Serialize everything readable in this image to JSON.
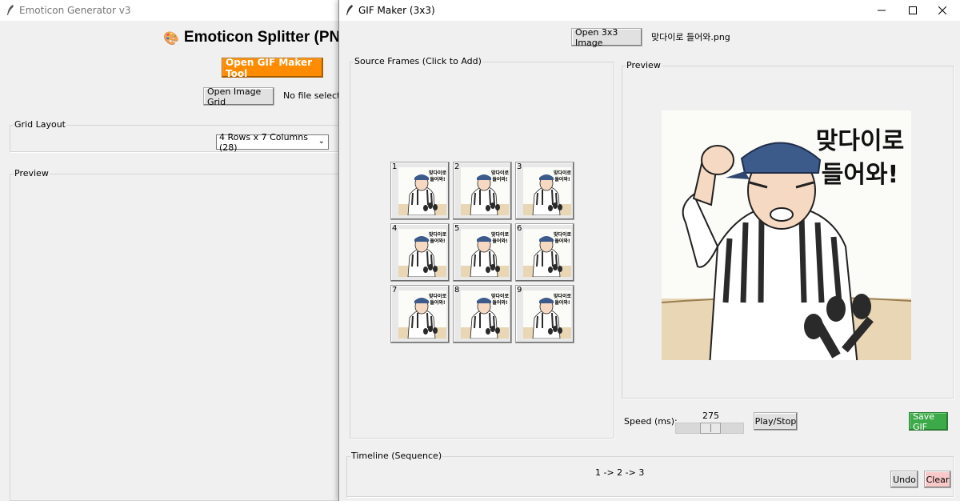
{
  "main_window": {
    "title": "Emoticon Generator v3",
    "heading": "Emoticon Splitter (PNG",
    "open_gif_button": "Open GIF Maker Tool",
    "open_grid_button": "Open Image Grid",
    "file_status": "No file selected",
    "grid_layout_label": "Grid Layout",
    "grid_select_value": "4 Rows x 7 Columns (28)",
    "preview_label": "Preview",
    "accent_orange": "#ff8c00"
  },
  "gif_window": {
    "title": "GIF Maker (3x3)",
    "open_button": "Open 3x3 Image",
    "file_name": "맞다이로 들어와.png",
    "source_frames_label": "Source Frames (Click to Add)",
    "preview_label": "Preview",
    "speed_label": "Speed (ms):",
    "speed_value": "275",
    "play_stop_button": "Play/Stop",
    "save_gif_button": "Save GIF",
    "timeline_label": "Timeline (Sequence)",
    "timeline_sequence": "1 -> 2 -> 3",
    "undo_button": "Undo",
    "clear_button": "Clear",
    "save_color": "#3daa4a",
    "clear_color": "#f9c8c8",
    "preview_caption_line1": "맞다이로",
    "preview_caption_line2": "들어와!",
    "thumb_caption_line1": "맞다이로",
    "thumb_caption_line2": "들어와!",
    "frames": [
      {
        "num": "1"
      },
      {
        "num": "2"
      },
      {
        "num": "3"
      },
      {
        "num": "4"
      },
      {
        "num": "5"
      },
      {
        "num": "6"
      },
      {
        "num": "7"
      },
      {
        "num": "8"
      },
      {
        "num": "9"
      }
    ]
  }
}
